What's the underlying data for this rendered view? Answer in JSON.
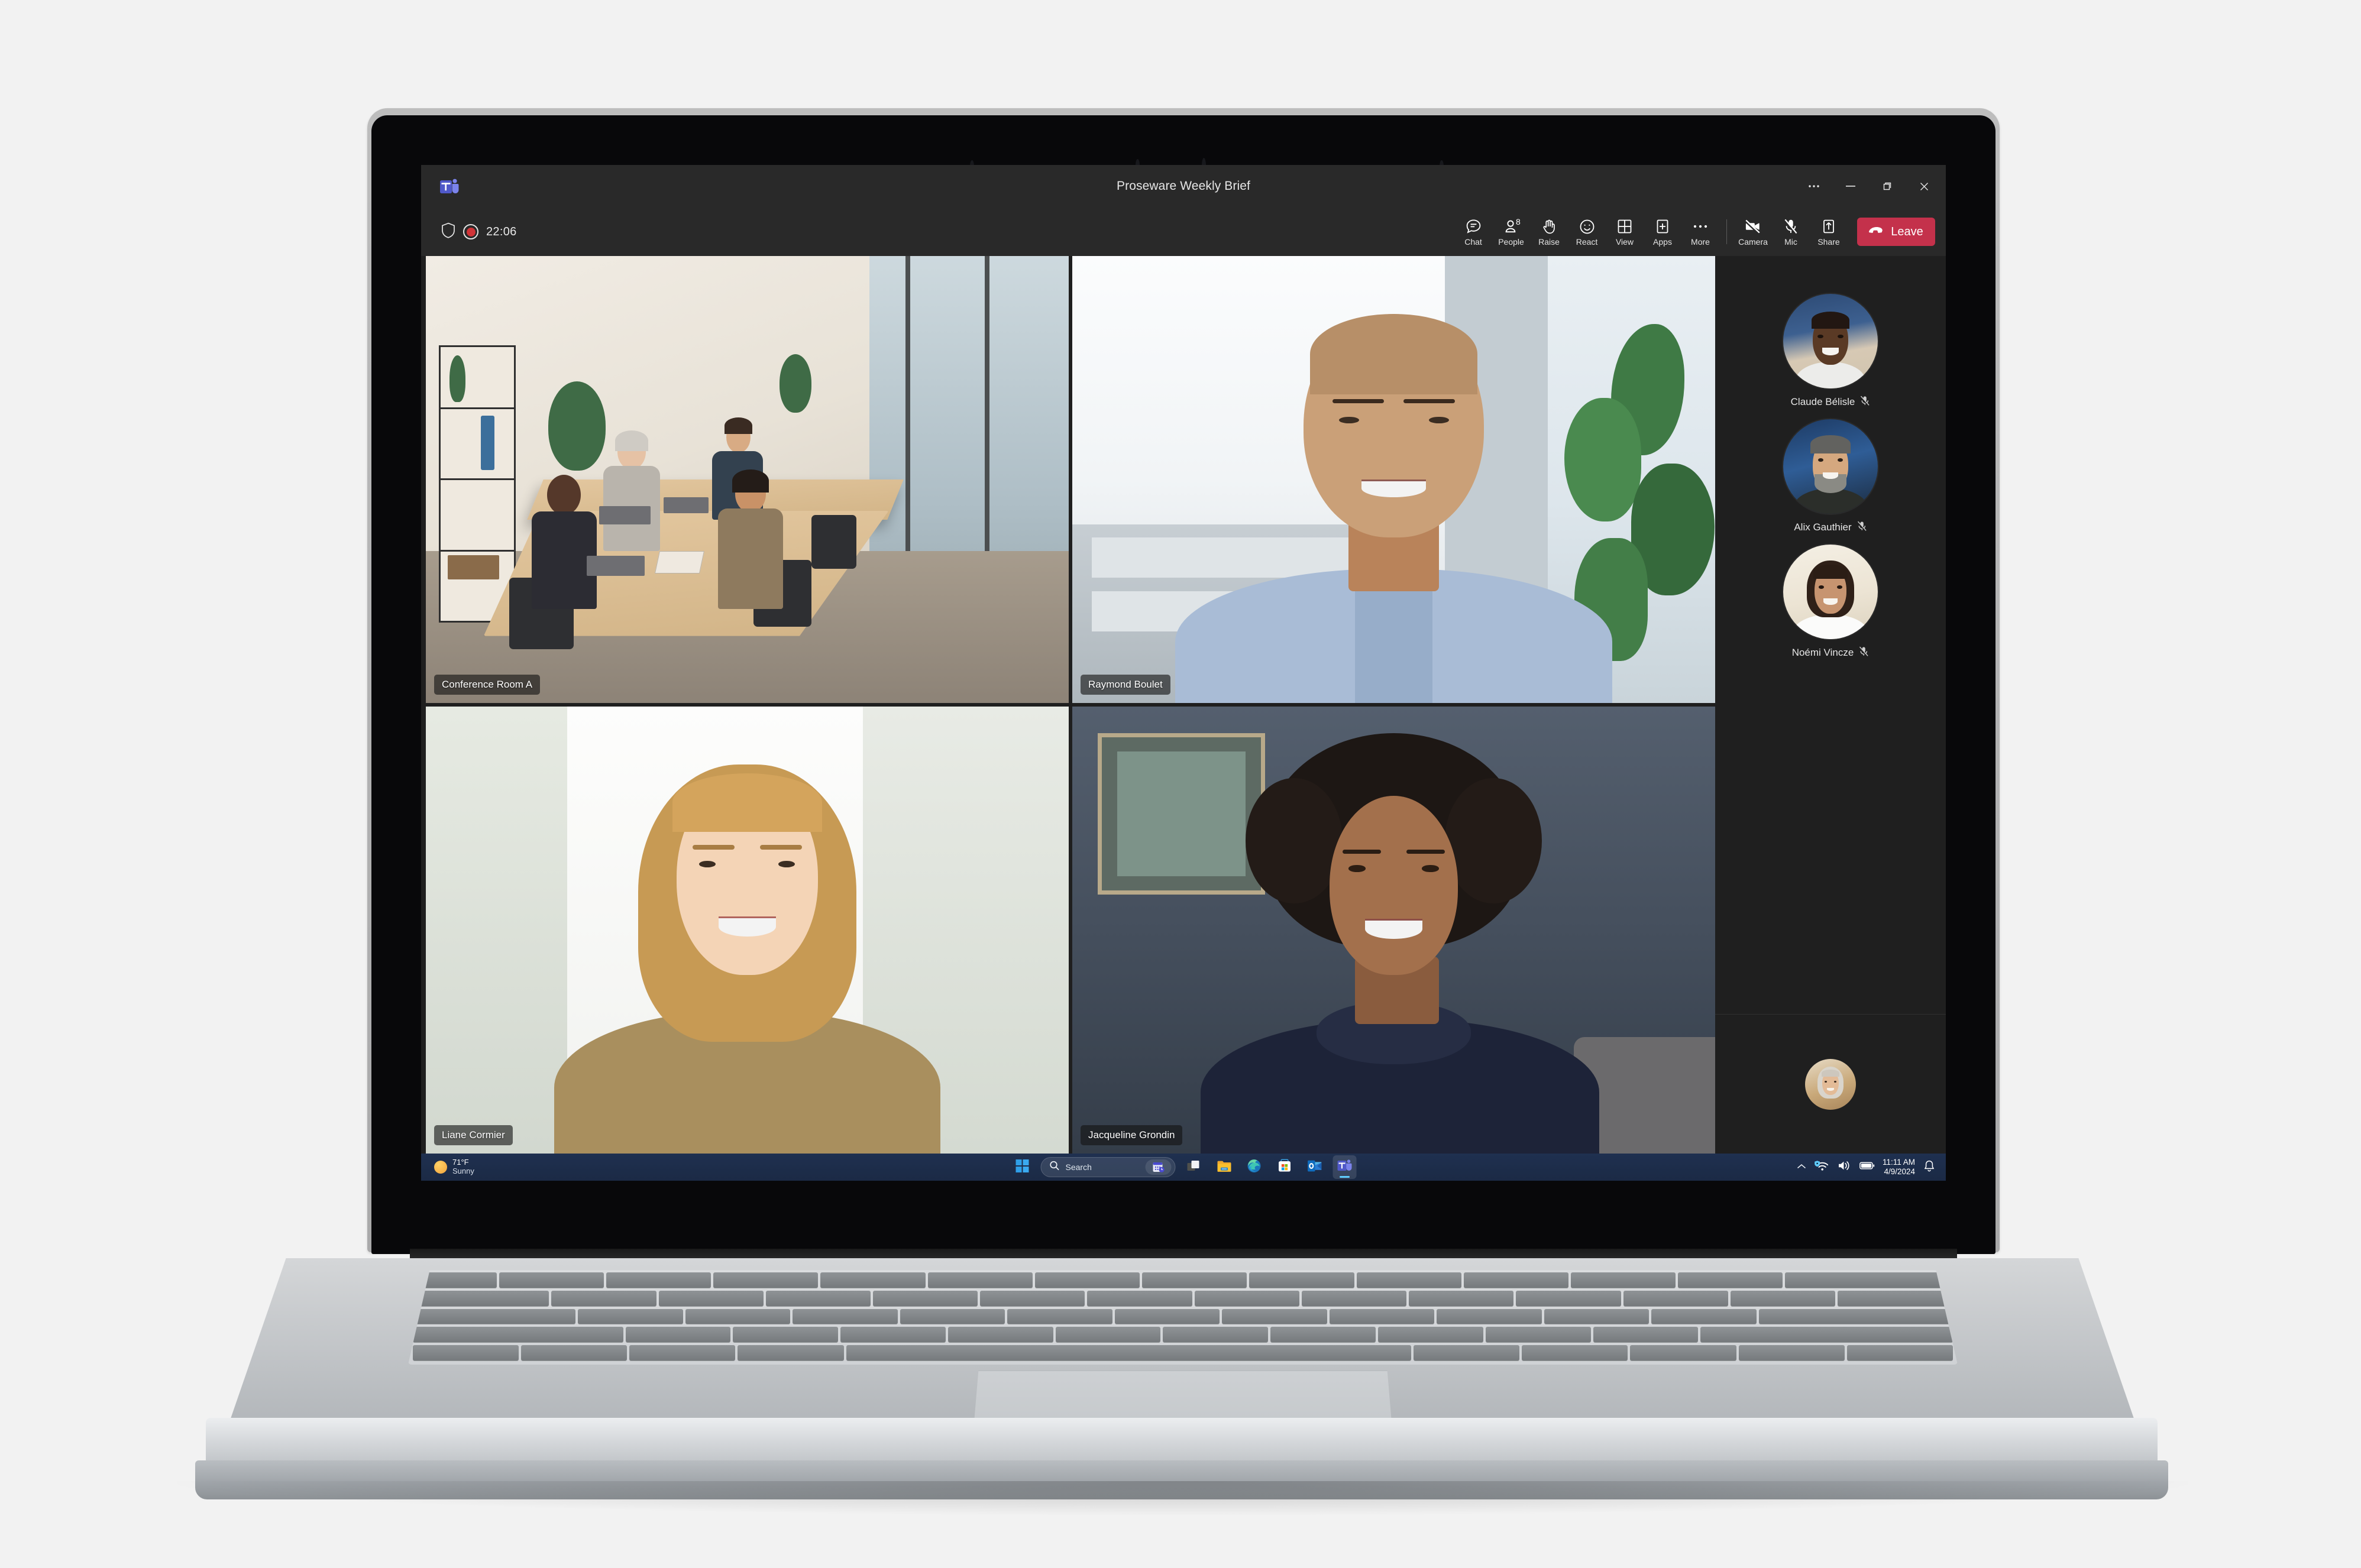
{
  "window": {
    "app_icon": "teams-icon",
    "title": "Proseware Weekly Brief",
    "more_options": "•••",
    "minimize": "–",
    "restore": "❐",
    "close": "✕"
  },
  "meeting": {
    "shield_icon": "shield-icon",
    "record_icon": "record-icon",
    "timer": "22:06"
  },
  "toolbar": {
    "items": [
      {
        "label": "Chat",
        "icon": "chat-icon"
      },
      {
        "label": "People",
        "icon": "people-icon",
        "badge": "8"
      },
      {
        "label": "Raise",
        "icon": "raise-hand-icon"
      },
      {
        "label": "React",
        "icon": "react-emoji-icon"
      },
      {
        "label": "View",
        "icon": "view-grid-icon"
      },
      {
        "label": "Apps",
        "icon": "apps-plus-icon"
      },
      {
        "label": "More",
        "icon": "more-ellipsis-icon"
      }
    ],
    "media": [
      {
        "label": "Camera",
        "icon": "camera-off-icon",
        "state": "off"
      },
      {
        "label": "Mic",
        "icon": "mic-off-icon",
        "state": "off"
      },
      {
        "label": "Share",
        "icon": "share-up-icon",
        "state": "on"
      }
    ],
    "leave": {
      "label": "Leave",
      "icon": "hangup-icon",
      "color": "#c4314b"
    }
  },
  "stage": {
    "tiles": [
      {
        "name": "Conference Room A",
        "spotlight": true,
        "kind": "room"
      },
      {
        "name": "Raymond Boulet",
        "spotlight": false,
        "kind": "person"
      },
      {
        "name": "Liane Cormier",
        "spotlight": false,
        "kind": "person"
      },
      {
        "name": "Jacqueline Grondin",
        "spotlight": false,
        "kind": "person"
      }
    ],
    "spotlight_color": "#8d8ce0"
  },
  "roster": {
    "participants": [
      {
        "name": "Claude Bélisle",
        "muted": true,
        "mute_icon": "mic-muted-icon"
      },
      {
        "name": "Alix Gauthier",
        "muted": true,
        "mute_icon": "mic-muted-icon"
      },
      {
        "name": "Noémi Vincze",
        "muted": true,
        "mute_icon": "mic-muted-icon"
      }
    ],
    "self_view": {
      "name": "self-avatar",
      "icon": "self-avatar"
    }
  },
  "taskbar": {
    "weather": {
      "icon": "sun-icon",
      "temperature": "71°F",
      "condition": "Sunny"
    },
    "start": {
      "icon": "windows-start-icon"
    },
    "search": {
      "icon": "search-icon",
      "placeholder": "Search",
      "widget_icon": "calendar-clock-icon"
    },
    "apps": [
      {
        "icon": "task-view-icon",
        "name": "Task View",
        "active": false
      },
      {
        "icon": "file-explorer-icon",
        "name": "File Explorer",
        "active": false
      },
      {
        "icon": "edge-icon",
        "name": "Microsoft Edge",
        "active": false
      },
      {
        "icon": "store-icon",
        "name": "Microsoft Store",
        "active": false
      },
      {
        "icon": "outlook-icon",
        "name": "Outlook",
        "active": false
      },
      {
        "icon": "teams-icon",
        "name": "Microsoft Teams",
        "active": true
      }
    ],
    "tray": [
      {
        "icon": "chevron-up-icon",
        "name": "Show hidden icons"
      },
      {
        "icon": "wifi-secure-icon",
        "name": "Network"
      },
      {
        "icon": "volume-icon",
        "name": "Volume"
      },
      {
        "icon": "battery-icon",
        "name": "Battery"
      }
    ],
    "clock": {
      "time": "11:11 AM",
      "date": "4/9/2024"
    },
    "notifications": {
      "icon": "bell-icon"
    }
  }
}
